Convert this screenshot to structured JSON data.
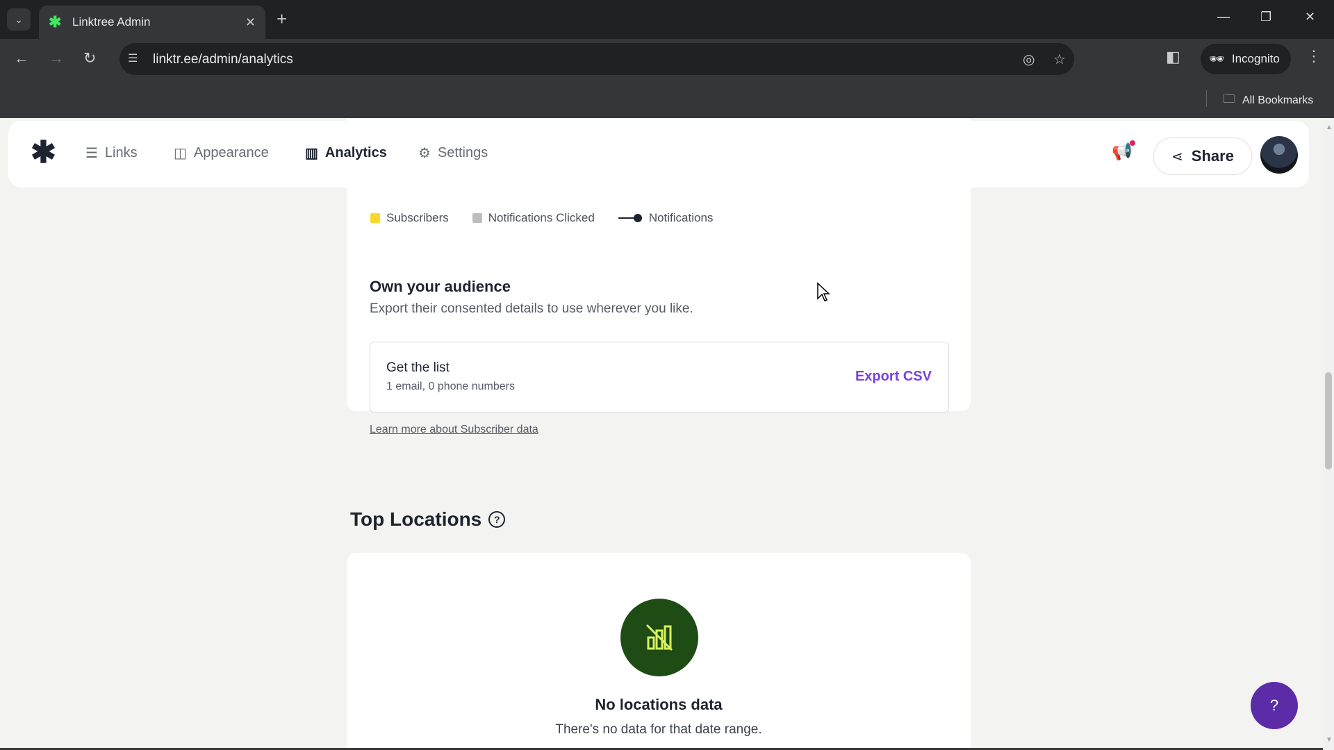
{
  "browser": {
    "tab_title": "Linktree Admin",
    "url": "linktr.ee/admin/analytics",
    "incognito_label": "Incognito",
    "bookmarks_label": "All Bookmarks"
  },
  "nav": {
    "items": [
      {
        "label": "Links",
        "icon": "list-icon",
        "active": false
      },
      {
        "label": "Appearance",
        "icon": "shapes-icon",
        "active": false
      },
      {
        "label": "Analytics",
        "icon": "bar-chart-icon",
        "active": true
      },
      {
        "label": "Settings",
        "icon": "gear-icon",
        "active": false
      }
    ],
    "share_label": "Share"
  },
  "legend": {
    "subscribers": "Subscribers",
    "clicked": "Notifications Clicked",
    "notifications": "Notifications"
  },
  "colors": {
    "subscribers": "#f8d92b",
    "clicked": "#bdbdbd",
    "accent": "#7b3fe4",
    "nodata_bg": "#1f4b14"
  },
  "audience": {
    "title": "Own your audience",
    "description": "Export their consented details to use wherever you like.",
    "list_title": "Get the list",
    "list_sub": "1 email, 0 phone numbers",
    "export_label": "Export CSV",
    "learn_more": "Learn more about Subscriber data"
  },
  "locations": {
    "heading": "Top Locations",
    "empty_title": "No locations data",
    "empty_desc": "There's no data for that date range."
  },
  "help_button": "?"
}
